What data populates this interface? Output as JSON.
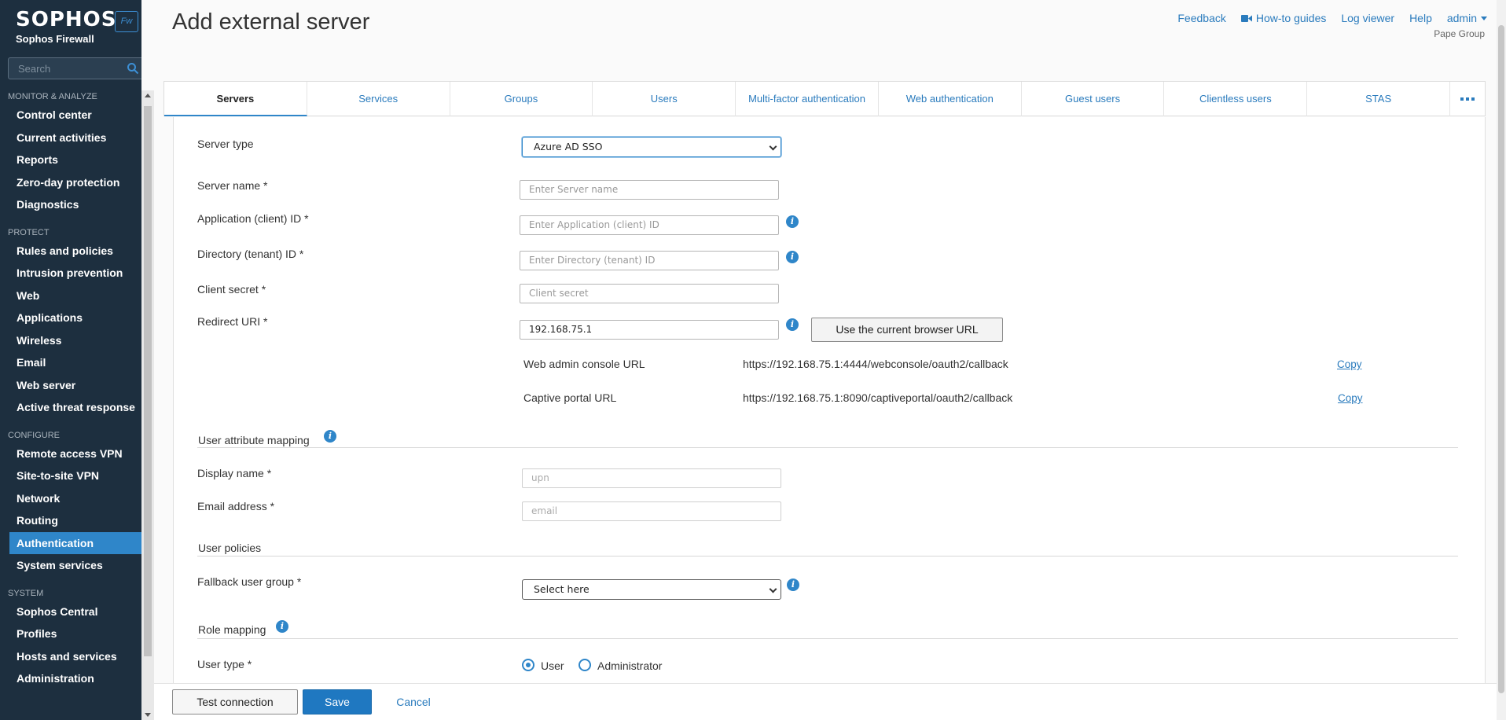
{
  "brand": {
    "logo": "SOPHOS",
    "product": "Sophos Firewall",
    "badge": "Fw"
  },
  "search": {
    "placeholder": "Search"
  },
  "sidebar": {
    "sections": [
      {
        "title": "MONITOR & ANALYZE",
        "items": [
          "Control center",
          "Current activities",
          "Reports",
          "Zero-day protection",
          "Diagnostics"
        ]
      },
      {
        "title": "PROTECT",
        "items": [
          "Rules and policies",
          "Intrusion prevention",
          "Web",
          "Applications",
          "Wireless",
          "Email",
          "Web server",
          "Active threat response"
        ]
      },
      {
        "title": "CONFIGURE",
        "items": [
          "Remote access VPN",
          "Site-to-site VPN",
          "Network",
          "Routing",
          "Authentication",
          "System services"
        ]
      },
      {
        "title": "SYSTEM",
        "items": [
          "Sophos Central",
          "Profiles",
          "Hosts and services",
          "Administration"
        ]
      }
    ],
    "active_item": "Authentication"
  },
  "header": {
    "title": "Add external server",
    "links": {
      "feedback": "Feedback",
      "howto": "How-to guides",
      "logviewer": "Log viewer",
      "help": "Help",
      "user": "admin"
    },
    "group": "Pape Group"
  },
  "tabs": [
    "Servers",
    "Services",
    "Groups",
    "Users",
    "Multi-factor authentication",
    "Web authentication",
    "Guest users",
    "Clientless users",
    "STAS"
  ],
  "active_tab": "Servers",
  "form": {
    "server_type": {
      "label": "Server type",
      "value": "Azure AD SSO"
    },
    "server_name": {
      "label": "Server name *",
      "placeholder": "Enter Server name"
    },
    "app_id": {
      "label": "Application (client) ID *",
      "placeholder": "Enter Application (client) ID"
    },
    "tenant_id": {
      "label": "Directory (tenant) ID *",
      "placeholder": "Enter Directory (tenant) ID"
    },
    "client_secret": {
      "label": "Client secret *",
      "placeholder": "Client secret"
    },
    "redirect_uri": {
      "label": "Redirect URI *",
      "value": "192.168.75.1",
      "button": "Use the current browser URL"
    },
    "web_admin_url": {
      "label": "Web admin console URL",
      "value": "https://192.168.75.1:4444/webconsole/oauth2/callback",
      "copy": "Copy"
    },
    "captive_url": {
      "label": "Captive portal URL",
      "value": "https://192.168.75.1:8090/captiveportal/oauth2/callback",
      "copy": "Copy"
    },
    "attr_mapping": {
      "title": "User attribute mapping",
      "display_name": {
        "label": "Display name *",
        "value": "upn"
      },
      "email": {
        "label": "Email address *",
        "value": "email"
      }
    },
    "user_policies": {
      "title": "User policies",
      "fallback_group": {
        "label": "Fallback user group *",
        "value": "Select here"
      }
    },
    "role_mapping": {
      "title": "Role mapping",
      "user_type": {
        "label": "User type *",
        "options": [
          "User",
          "Administrator"
        ],
        "selected": "User"
      }
    }
  },
  "footer": {
    "test": "Test connection",
    "save": "Save",
    "cancel": "Cancel"
  },
  "colors": {
    "sidebar_bg": "#1d2f3f",
    "accent": "#2f86c9",
    "link": "#2a7bbd"
  }
}
